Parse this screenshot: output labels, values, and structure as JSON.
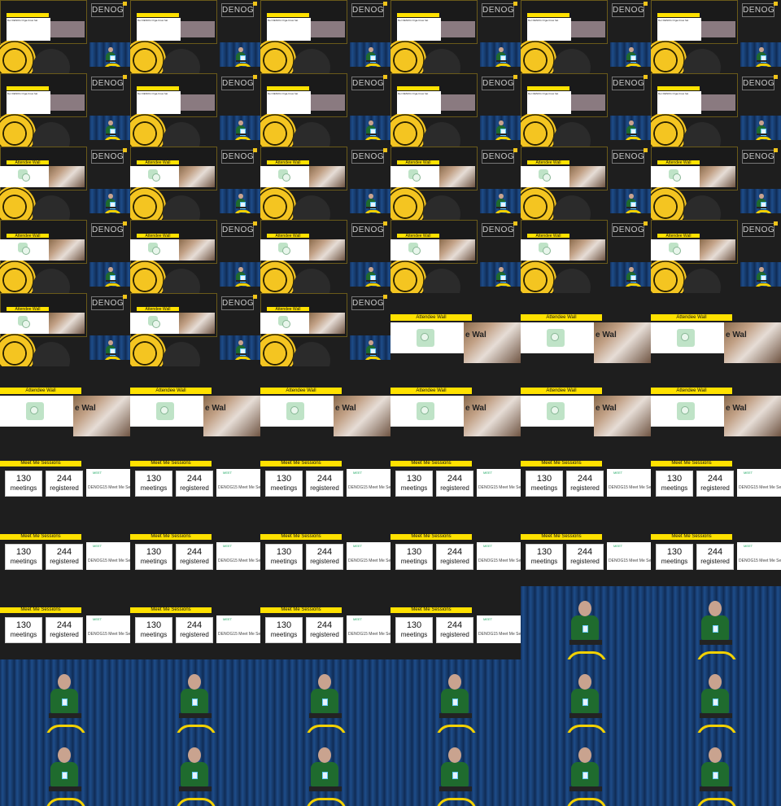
{
  "frames": [
    "agenda",
    "agenda",
    "agenda",
    "agenda",
    "agenda",
    "agenda",
    "agenda",
    "agenda",
    "agenda",
    "agenda",
    "agenda",
    "agenda",
    "attendee_split",
    "attendee_split",
    "attendee_split",
    "attendee_split",
    "attendee_split",
    "attendee_split",
    "attendee_split",
    "attendee_split",
    "attendee_split",
    "attendee_split",
    "attendee_split",
    "attendee_split",
    "attendee_split",
    "attendee_split",
    "attendee_split",
    "attendee_full",
    "attendee_full",
    "attendee_full",
    "attendee_full",
    "attendee_full",
    "attendee_full",
    "attendee_full",
    "attendee_full",
    "attendee_full",
    "meet",
    "meet",
    "meet",
    "meet",
    "meet",
    "meet",
    "meet",
    "meet",
    "meet",
    "meet",
    "meet",
    "meet",
    "meet",
    "meet",
    "meet",
    "meet",
    "speaker",
    "speaker",
    "speaker",
    "speaker",
    "speaker",
    "speaker",
    "speaker",
    "speaker",
    "speaker",
    "speaker",
    "speaker",
    "speaker",
    "speaker",
    "speaker"
  ],
  "labels": {
    "logo": "DENOG",
    "agenda_line1": "Der DENOG Orga-Crew hat",
    "attendee_title": "Attendee Wall",
    "attendee_wall_text": "e Wal",
    "meet_title": "Meet Me Sessions",
    "meet_value1": "130",
    "meet_label1": "meetings",
    "meet_value2": "244",
    "meet_label2": "registered",
    "meet_brand": "MEET",
    "meet_caption": "DENOG15 Meet Me Sess"
  },
  "colors": {
    "yellow": "#ffe100",
    "background": "#1e1e1e",
    "curtain": "#1e4d8a"
  }
}
